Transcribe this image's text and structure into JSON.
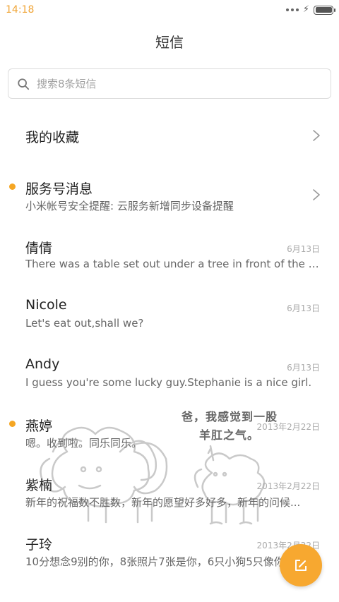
{
  "status_bar": {
    "time": "14:18",
    "battery_level": 1.0
  },
  "header": {
    "title": "短信"
  },
  "search": {
    "placeholder": "搜索8条短信"
  },
  "conversations": [
    {
      "title": "我的收藏",
      "preview": "",
      "date": "",
      "unread": false,
      "has_chevron": true
    },
    {
      "title": "服务号消息",
      "preview": "小米帐号安全提醒: 云服务新增同步设备提醒",
      "date": "",
      "unread": true,
      "has_chevron": true
    },
    {
      "title": "倩倩",
      "preview": "There was a table set out under a tree in front of the ho...",
      "date": "6月13日",
      "unread": false,
      "has_chevron": false
    },
    {
      "title": "Nicole",
      "preview": "Let's eat out,shall we?",
      "date": "6月13日",
      "unread": false,
      "has_chevron": false
    },
    {
      "title": "Andy",
      "preview": "I guess you're some lucky guy.Stephanie is a nice girl.",
      "date": "6月13日",
      "unread": false,
      "has_chevron": false
    },
    {
      "title": "燕婷",
      "preview": "嗯。收到啦。同乐同乐。",
      "date": "2013年2月22日",
      "unread": true,
      "has_chevron": false
    },
    {
      "title": "紫楠",
      "preview": "新年的祝福数不胜数，新年的愿望好多好多，新年的问候...",
      "date": "2013年2月22日",
      "unread": false,
      "has_chevron": false
    },
    {
      "title": "子玲",
      "preview": "10分想念9别的你，8张照片7张是你，6只小狗5只像你...",
      "date": "2013年2月22日",
      "unread": false,
      "has_chevron": false
    }
  ],
  "watermark": {
    "line1": "爸，我感觉到一股",
    "line2": "羊肛之气。"
  },
  "fab": {
    "icon": "compose-icon",
    "color": "#f7a830"
  },
  "colors": {
    "accent": "#f5a623",
    "time": "#f0a537"
  }
}
